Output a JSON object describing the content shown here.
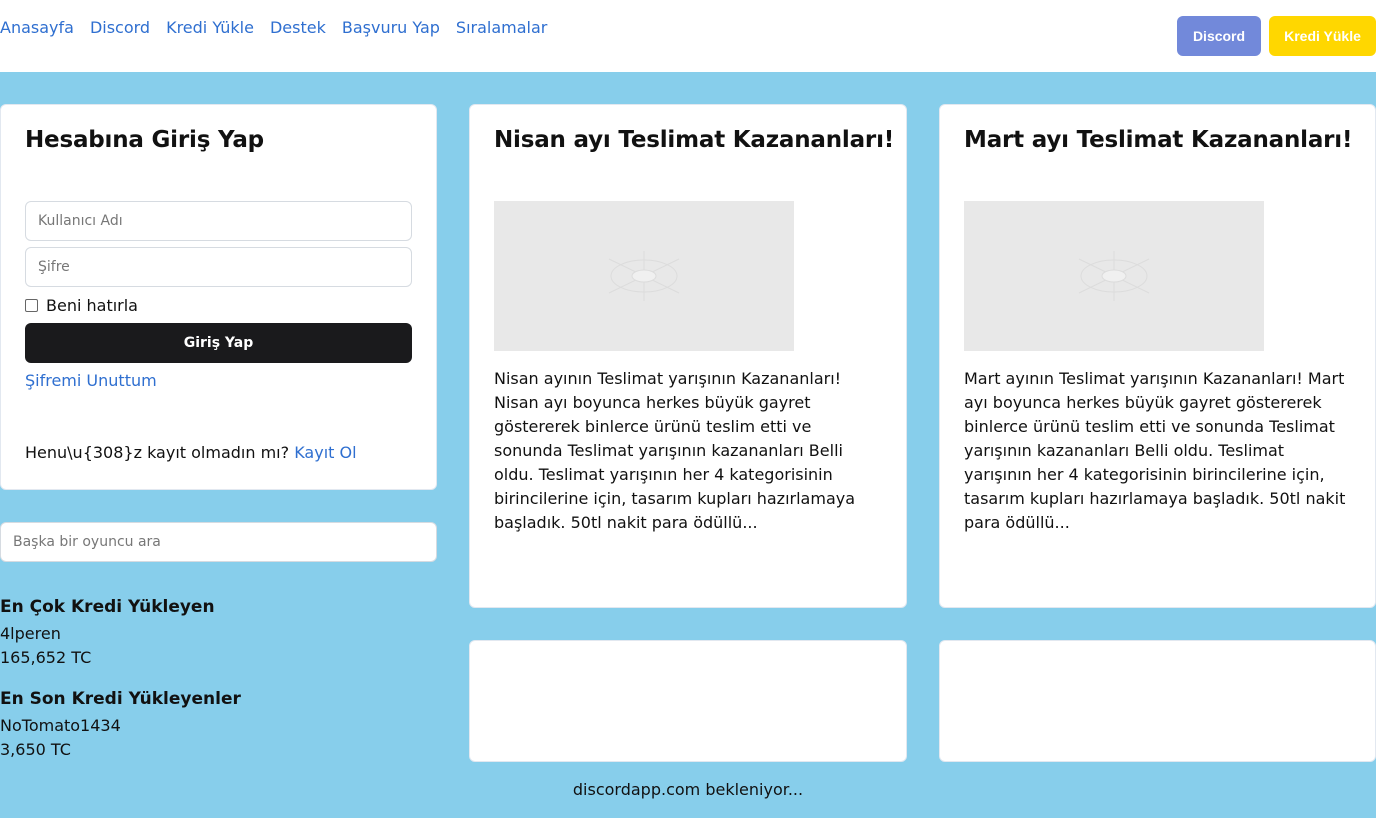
{
  "nav": {
    "links": [
      "Anasayfa",
      "Discord",
      "Kredi Yükle",
      "Destek",
      "Başvuru Yap",
      "Sıralamalar"
    ],
    "discord_button": "Discord",
    "kredi_button": "Kredi Yükle"
  },
  "login": {
    "title": "Hesabına Giriş Yap",
    "username_placeholder": "Kullanıcı Adı",
    "password_placeholder": "Şifre",
    "remember_label": "Beni hatırla",
    "submit_label": "Giriş Yap",
    "forgot_label": "Şifremi Unuttum",
    "register_prompt": "Henu\\u{308}z kayıt olmadın mı?",
    "register_link": "Kayıt Ol"
  },
  "search": {
    "placeholder": "Başka bir oyuncu ara"
  },
  "leaders": {
    "top_title": "En Çok Kredi Yükleyen",
    "top_name": "4lperen",
    "top_amount": "165,652 TC",
    "recent_title": "En Son Kredi Yükleyenler",
    "recent_name": "NoTomato1434",
    "recent_amount": "3,650 TC"
  },
  "news": [
    {
      "title": "Nisan ayı Teslimat Kazananları!",
      "text": "Nisan ayının Teslimat yarışının Kazananları! Nisan ayı boyunca herkes büyük gayret göstererek binlerce ürünü teslim etti ve sonunda Teslimat yarışının kazananları Belli oldu. Teslimat yarışının her 4 kategorisinin birincilerine için, tasarım kupları hazırlamaya başladık. 50tl nakit para ödüllü..."
    },
    {
      "title": "Mart ayı Teslimat Kazananları!",
      "text": "Mart ayının Teslimat yarışının Kazananları! Mart ayı boyunca herkes büyük gayret göstererek binlerce ürünü teslim etti ve sonunda Teslimat yarışının kazananları Belli oldu. Teslimat yarışının her 4 kategorisinin birincilerine için, tasarım kupları hazırlamaya başladık. 50tl nakit para ödüllü..."
    }
  ],
  "status": "discordapp.com bekleniyor...",
  "colors": {
    "background": "#87ceeb",
    "link": "#2f6fd0",
    "discord": "#7289da",
    "kredi": "#ffd700",
    "submit": "#1a1a1c"
  }
}
